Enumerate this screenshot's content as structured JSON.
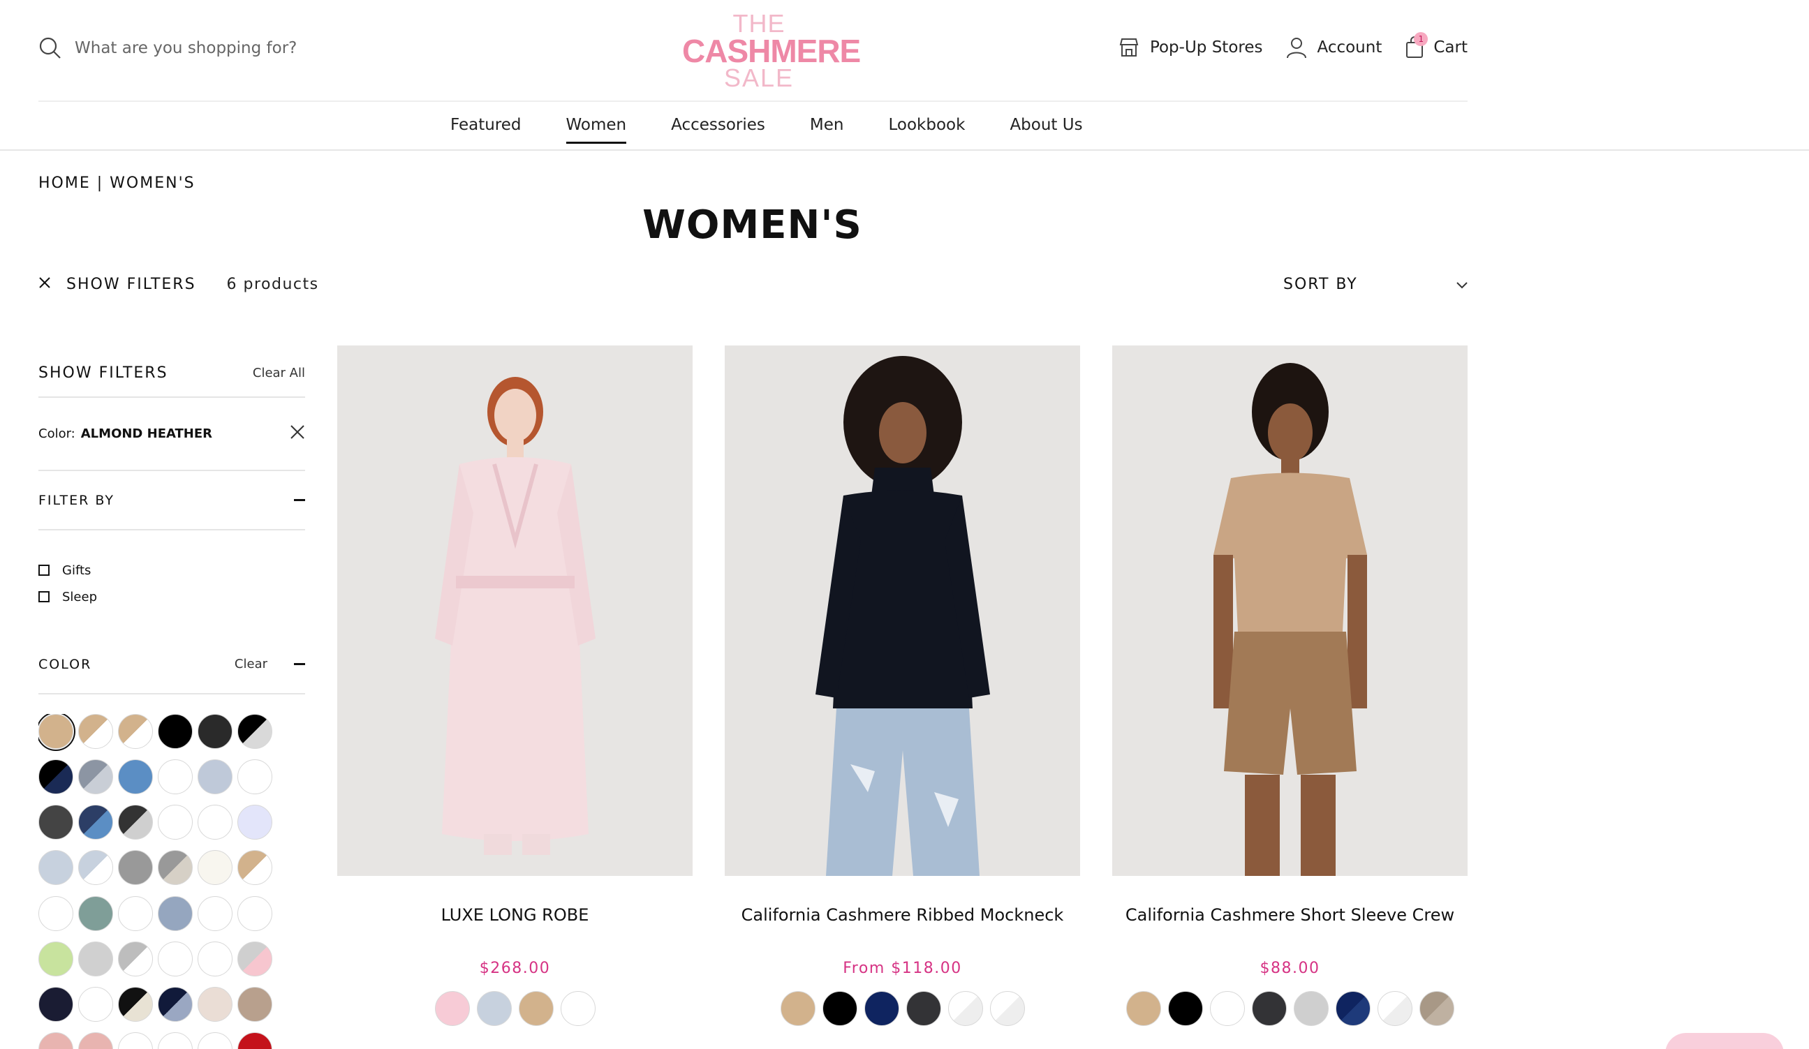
{
  "search": {
    "placeholder": "What are you shopping for?"
  },
  "logo": {
    "line1": "THE",
    "line2": "CASHMERE",
    "line3": "SALE"
  },
  "header_links": {
    "popup": "Pop-Up Stores",
    "account": "Account",
    "cart": "Cart",
    "cart_count": "1"
  },
  "nav": [
    "Featured",
    "Women",
    "Accessories",
    "Men",
    "Lookbook",
    "About Us"
  ],
  "nav_active": "Women",
  "breadcrumb": {
    "home": "HOME",
    "sep": " | ",
    "current": "WOMEN'S"
  },
  "page_title": "WOMEN'S",
  "toolbar": {
    "toggle_label": "SHOW FILTERS",
    "count": "6 products",
    "sort_label": "SORT BY"
  },
  "sidebar": {
    "title": "SHOW FILTERS",
    "clear_all": "Clear All",
    "active_filter_label": "Color:",
    "active_filter_value": "ALMOND HEATHER",
    "filter_by": "FILTER BY",
    "options": [
      "Gifts",
      "Sleep"
    ],
    "color_title": "COLOR",
    "color_clear": "Clear"
  },
  "color_swatches": [
    "#d2b28c",
    "split:#d2b28c:#ffffff",
    "split:#d2b28c:#ffffff",
    "#000000",
    "#2a2a2a",
    "split:#000000:#d9d9d9",
    "split:#000000:#1a2a55",
    "split:#8c95a3:#c9ced6",
    "#5b8ec4",
    "#ffffff",
    "#bfc9d9",
    "#ffffff",
    "#444444",
    "split:#2c3e66:#5b8ec4",
    "split:#333333:#cfcfcf",
    "#ffffff",
    "#ffffff",
    "#e3e5fa",
    "#c7d1de",
    "split:#c7d1de:#ffffff",
    "#999999",
    "split:#999999:#d6d0c6",
    "#f8f6ef",
    "split:#d2b28c:#ffffff",
    "#ffffff",
    "#7f9e98",
    "#ffffff",
    "#95a6bf",
    "#ffffff",
    "#ffffff",
    "#c8e39e",
    "#d0d0d0",
    "split:#bdbdbd:#ffffff",
    "#ffffff",
    "#ffffff",
    "split:#cfcfcf:#f7c6cf",
    "#1a1c33",
    "#ffffff",
    "split:#111111:#e8e2d4",
    "split:#111a3a:#9aa7c2",
    "#eaddd5",
    "#b8a08d",
    "#e8b4b0",
    "#e8b4b0",
    "#ffffff",
    "#ffffff",
    "#ffffff",
    "#c4121b"
  ],
  "products": [
    {
      "name": "LUXE LONG ROBE",
      "price": "$268.00",
      "swatches": [
        "#f7cbd6",
        "#c7d1de",
        "#d2b28c",
        "#ffffff"
      ]
    },
    {
      "name": "California Cashmere Ribbed Mockneck",
      "price": "From $118.00",
      "swatches": [
        "#d2b28c",
        "#000000",
        "#0f2460",
        "#333336",
        "split:#ffffff:#eeeeee",
        "split:#ffffff:#eeeeee"
      ]
    },
    {
      "name": "California Cashmere Short Sleeve Crew",
      "price": "$88.00",
      "swatches": [
        "#d2b28c",
        "#000000",
        "#ffffff",
        "#333336",
        "#cfcfcf",
        "split:#0f2460:#1e3a7a",
        "split:#ffffff:#eeeeee",
        "split:#a89886:#bfb1a1"
      ]
    }
  ],
  "colors": {
    "accent_pink": "#d63384",
    "logo_pink": "#ee88a6"
  }
}
